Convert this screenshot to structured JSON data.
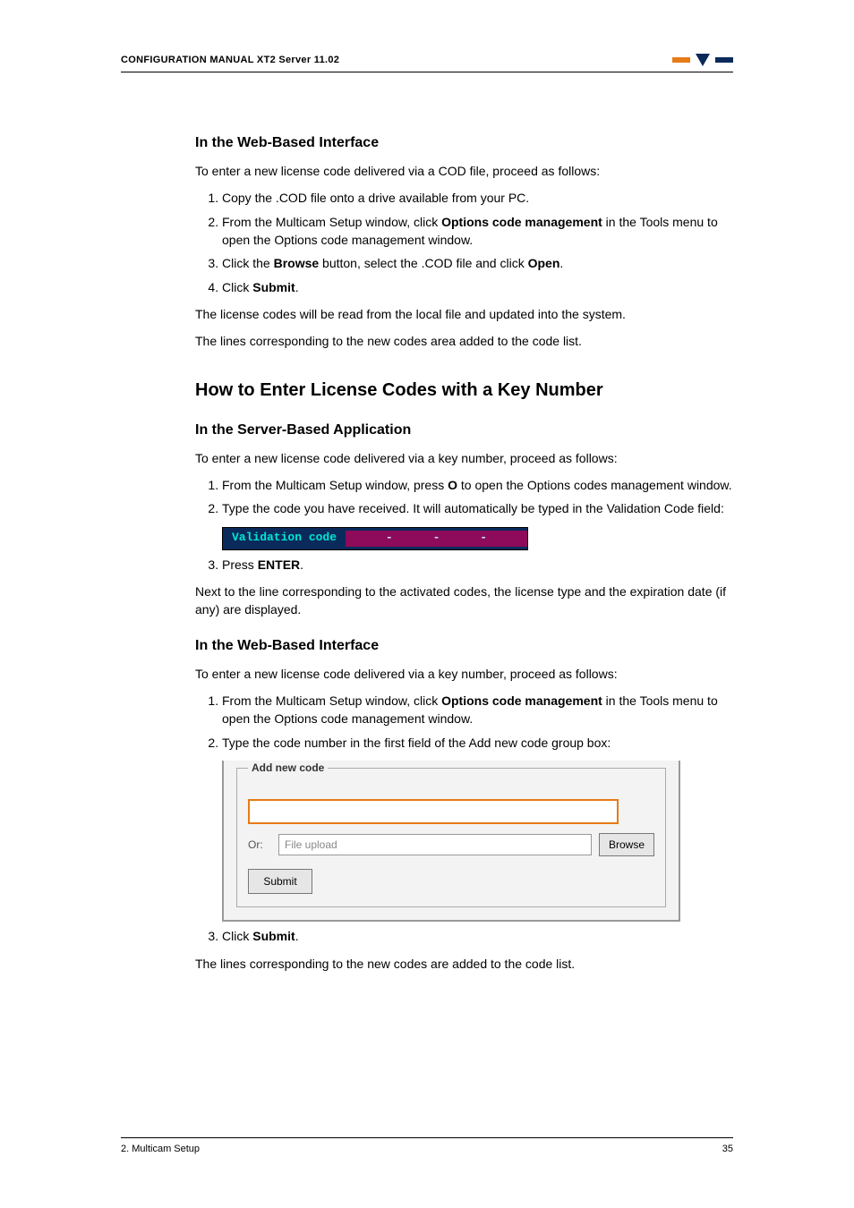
{
  "header": {
    "title": "CONFIGURATION MANUAL   XT2 Server 11.02"
  },
  "s1": {
    "h": "In the Web-Based Interface",
    "intro": "To enter a new license code delivered via a COD file, proceed as follows:",
    "li1": "Copy the .COD file onto a drive available from your PC.",
    "li2a": "From the Multicam Setup window, click ",
    "li2b": "Options code management",
    "li2c": " in the Tools menu to open the Options code management window.",
    "li3a": "Click the ",
    "li3b": "Browse",
    "li3c": " button, select the .COD file and click ",
    "li3d": "Open",
    "li3e": ".",
    "li4a": "Click ",
    "li4b": "Submit",
    "li4c": ".",
    "p1": "The license codes will be read from the local file and updated into the system.",
    "p2": "The lines corresponding to the new codes area added to the code list."
  },
  "s2": {
    "h": "How to Enter License Codes with a Key Number"
  },
  "s3": {
    "h": "In the Server-Based Application",
    "intro": "To enter a new license code delivered via a key number, proceed as follows:",
    "li1a": "From the Multicam Setup window, press ",
    "li1b": "O",
    "li1c": " to open the Options codes management window.",
    "li2": "Type the code you have received. It will automatically be typed in the Validation Code field:",
    "vcLabel": "Validation code",
    "vcDash": "-",
    "li3a": "Press ",
    "li3b": "ENTER",
    "li3c": ".",
    "p1": "Next to the line corresponding to the activated codes, the license type and the expiration date (if any) are displayed."
  },
  "s4": {
    "h": "In the Web-Based Interface",
    "intro": "To enter a new license code delivered via a key number, proceed as follows:",
    "li1a": "From the Multicam Setup window, click ",
    "li1b": "Options code management",
    "li1c": " in the Tools menu to open the Options code management window.",
    "li2": "Type the code number in the first field of the Add new code group box:",
    "anc": {
      "legend": "Add new code",
      "or": "Or:",
      "filePlaceholder": "File upload",
      "browse": "Browse",
      "submit": "Submit"
    },
    "li3a": "Click ",
    "li3b": "Submit",
    "li3c": ".",
    "p1": "The lines corresponding to the new codes are added to the code list."
  },
  "footer": {
    "left": "2. Multicam Setup",
    "right": "35"
  }
}
